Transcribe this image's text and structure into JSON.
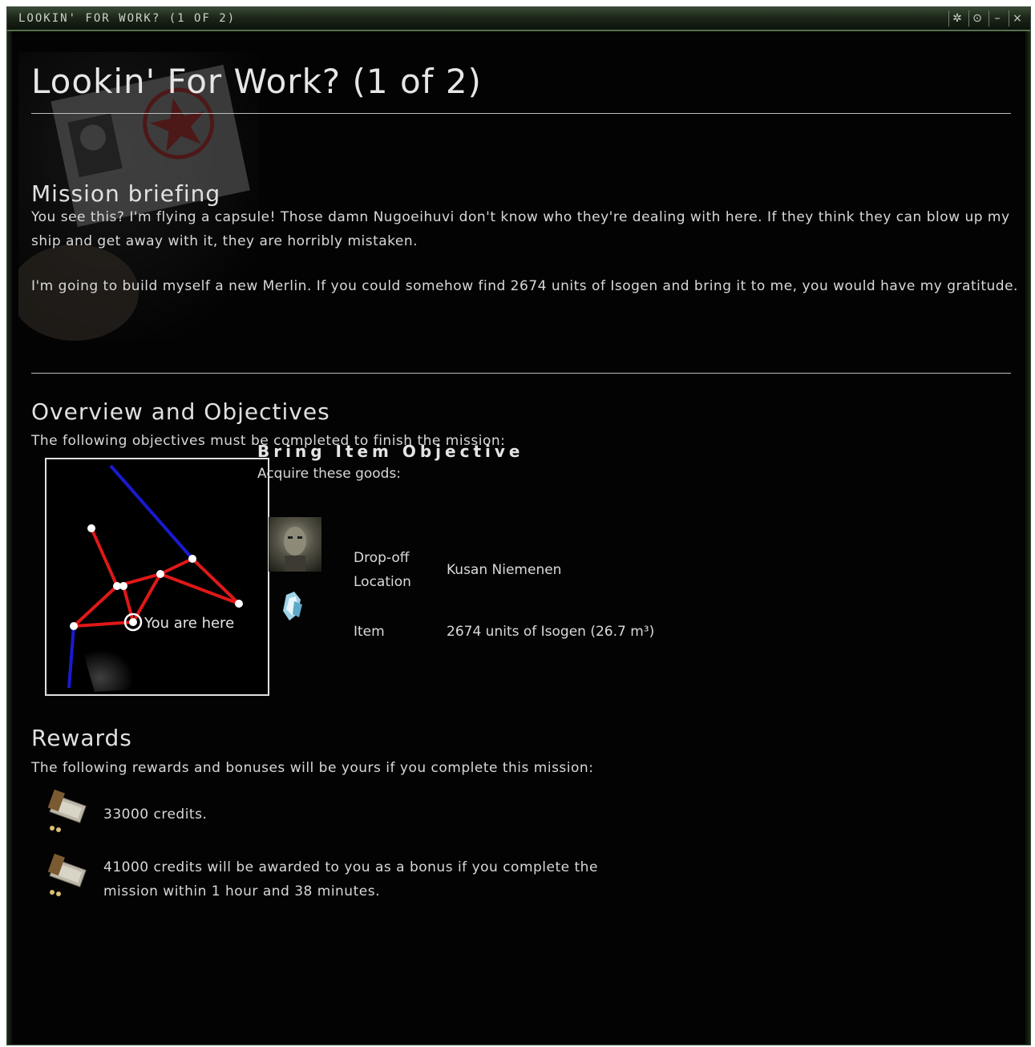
{
  "window": {
    "title": "LOOKIN' FOR WORK? (1 OF 2)",
    "controls": [
      "settings-icon",
      "pin-icon",
      "minimize-icon",
      "close-icon"
    ]
  },
  "page": {
    "heading": "Lookin' For Work? (1 of 2)"
  },
  "briefing": {
    "heading": "Mission briefing",
    "paragraph1": "You see this? I'm flying a capsule! Those damn Nugoeihuvi don't know who they're dealing with here. If they think they can blow up my ship and get away with it, they are horribly mistaken.",
    "paragraph2": "I'm going to build myself a new Merlin. If you could somehow find 2674 units of Isogen and bring it to me, you would have my gratitude."
  },
  "overview": {
    "heading": "Overview and Objectives",
    "intro": "The following objectives must be completed to finish the mission:",
    "map_label": "You are here",
    "objective_title": "Bring Item Objective",
    "objective_sub": "Acquire these goods:",
    "rows": [
      {
        "label_line1": "Drop-off",
        "label_line2": "Location",
        "value": "Kusan Niemenen",
        "icon": "agent-portrait-icon"
      },
      {
        "label": "Item",
        "value": "2674 units of Isogen (26.7 m³)",
        "icon": "isogen-icon"
      }
    ]
  },
  "rewards": {
    "heading": "Rewards",
    "intro": "The following rewards and bonuses will be yours if you complete this mission:",
    "items": [
      {
        "text": "33000 credits.",
        "icon": "isk-credits-icon"
      },
      {
        "line1": "41000 credits will be awarded to you as a bonus if you complete the",
        "line2": "mission within 1 hour and 38 minutes.",
        "icon": "isk-credits-icon"
      }
    ]
  },
  "colors": {
    "route_red": "#e01818",
    "route_blue": "#1a1ad0",
    "titlebar_green": "#55704c"
  }
}
